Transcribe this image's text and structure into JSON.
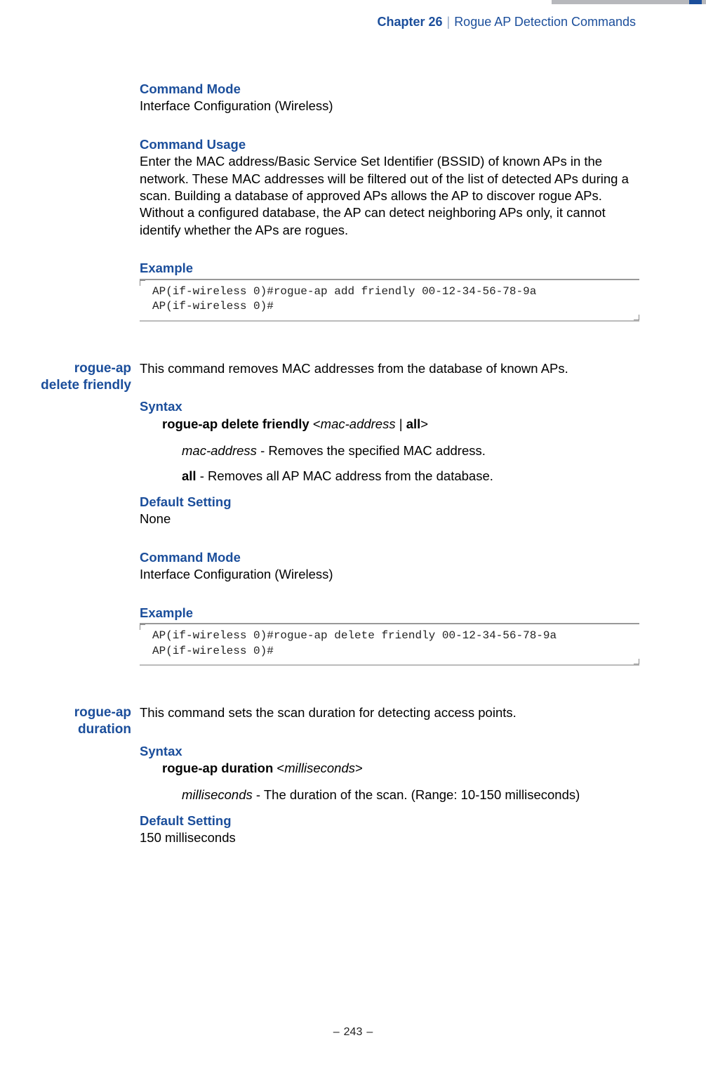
{
  "header": {
    "chapter": "Chapter 26",
    "title": "Rogue AP Detection Commands"
  },
  "section1": {
    "cmdmode_h": "Command Mode",
    "cmdmode_t": "Interface Configuration (Wireless)",
    "usage_h": "Command Usage",
    "usage_t": "Enter the MAC address/Basic Service Set Identifier (BSSID) of known APs in the network. These MAC addresses will be filtered out of the list of detected APs during a scan. Building a database of approved APs allows the AP to discover rogue APs. Without a configured database, the AP can detect neighboring APs only, it cannot identify whether the APs are rogues.",
    "example_h": "Example",
    "example_code": "AP(if-wireless 0)#rogue-ap add friendly 00-12-34-56-78-9a\nAP(if-wireless 0)#"
  },
  "section2": {
    "side": "rogue-ap delete friendly",
    "intro": "This command removes MAC addresses from the database of known APs.",
    "syntax_h": "Syntax",
    "syntax_cmd_b": "rogue-ap delete friendly ",
    "syntax_cmd_lt": "<",
    "syntax_cmd_i": "mac-address",
    "syntax_cmd_mid": " | ",
    "syntax_cmd_all": "all",
    "syntax_cmd_gt": ">",
    "p1_i": "mac-address",
    "p1_t": " - Removes the specified MAC address.",
    "p2_b": "all",
    "p2_t": " - Removes all AP MAC address from the database.",
    "default_h": "Default Setting",
    "default_t": "None",
    "cmdmode_h": "Command Mode",
    "cmdmode_t": "Interface Configuration (Wireless)",
    "example_h": "Example",
    "example_code": "AP(if-wireless 0)#rogue-ap delete friendly 00-12-34-56-78-9a\nAP(if-wireless 0)#"
  },
  "section3": {
    "side": "rogue-ap duration",
    "intro": "This command sets the scan duration for detecting access points.",
    "syntax_h": "Syntax",
    "syntax_cmd_b": "rogue-ap duration ",
    "syntax_cmd_lt": "<",
    "syntax_cmd_i": "milliseconds",
    "syntax_cmd_gt": ">",
    "p1_i": "milliseconds",
    "p1_t": " - The duration of the scan. (Range: 10-150 milliseconds)",
    "default_h": "Default Setting",
    "default_t": "150 milliseconds"
  },
  "footer": {
    "page": "243"
  }
}
